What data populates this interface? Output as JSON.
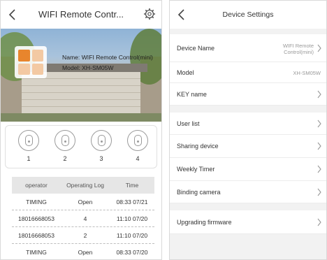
{
  "left_screen": {
    "header": {
      "title": "WIFI Remote Contr..."
    },
    "hero": {
      "name_label": "Name: WIFI Remote Control(mini)",
      "model_label": "Model: XH-SM05W",
      "icon_colors": {
        "primary": "#e8852d",
        "secondary": "#f3c9a3"
      }
    },
    "keys": [
      {
        "label": "1"
      },
      {
        "label": "2"
      },
      {
        "label": "3"
      },
      {
        "label": "4"
      }
    ],
    "log": {
      "headers": [
        "operator",
        "Operating Log",
        "Time"
      ],
      "rows": [
        [
          "TIMING",
          "Open",
          "08:33 07/21"
        ],
        [
          "18016668053",
          "4",
          "11:10 07/20"
        ],
        [
          "18016668053",
          "2",
          "11:10 07/20"
        ],
        [
          "TIMING",
          "Open",
          "08:33 07/20"
        ]
      ]
    }
  },
  "right_screen": {
    "header": {
      "title": "Device Settings"
    },
    "rows": {
      "device_name": {
        "label": "Device Name",
        "value_line1": "WIFI Remote",
        "value_line2": "Control(mini)"
      },
      "model": {
        "label": "Model",
        "value": "XH-SM05W"
      },
      "key_name": {
        "label": "KEY name"
      },
      "user_list": {
        "label": "User list"
      },
      "sharing_device": {
        "label": "Sharing device"
      },
      "weekly_timer": {
        "label": "Weekly Timer"
      },
      "binding_camera": {
        "label": "Binding camera"
      },
      "upgrading_firmware": {
        "label": "Upgrading firmware"
      }
    }
  },
  "icons": [
    "back-arrow-icon",
    "gear-icon",
    "remote-key-icon",
    "chevron-right-icon"
  ]
}
